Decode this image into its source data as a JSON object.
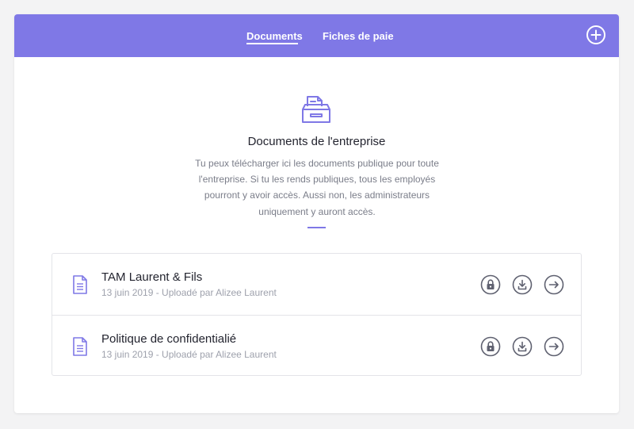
{
  "tabs": [
    {
      "label": "Documents",
      "active": true
    },
    {
      "label": "Fiches de paie",
      "active": false
    }
  ],
  "header": {
    "add_icon": "plus-circle-icon",
    "bar_color": "#7f78e6"
  },
  "hero": {
    "icon": "document-tray-icon",
    "title": "Documents de l'entreprise",
    "description": "Tu peux télécharger ici les documents publique pour toute l'entreprise. Si tu les rends publiques, tous les employés pourront y avoir accès. Aussi non, les administrateurs uniquement y auront accès."
  },
  "documents": [
    {
      "title": "TAM Laurent & Fils",
      "meta": "13 juin 2019 - Uploadé par Alizee Laurent",
      "actions": [
        "lock-icon",
        "download-icon",
        "arrow-right-icon"
      ]
    },
    {
      "title": "Politique de confidentialié",
      "meta": "13 juin 2019 - Uploadé par Alizee Laurent",
      "actions": [
        "lock-icon",
        "download-icon",
        "arrow-right-icon"
      ]
    }
  ],
  "colors": {
    "accent": "#7f78e6",
    "icon_gray": "#5f6170",
    "text_muted": "#7a7d89"
  }
}
